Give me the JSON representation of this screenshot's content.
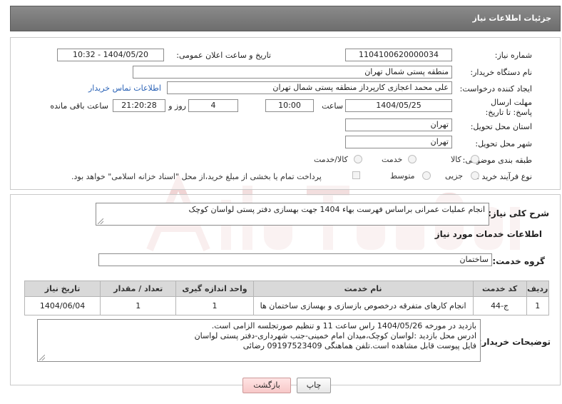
{
  "header": {
    "title": "جزئیات اطلاعات نیاز"
  },
  "fields": {
    "need_number_label": "شماره نیاز:",
    "need_number": "1104100620000034",
    "announce_label": "تاریخ و ساعت اعلان عمومی:",
    "announce_value": "1404/05/20 - 10:32",
    "buyer_org_label": "نام دستگاه خریدار:",
    "buyer_org": "منطقه پستی شمال تهران",
    "requester_label": "ایجاد کننده درخواست:",
    "requester": "علی محمد اعجازی کارپرداز منطقه پستی شمال تهران",
    "contact_link": "اطلاعات تماس خریدار",
    "deadline_label": "مهلت ارسال پاسخ: تا تاریخ:",
    "deadline_date": "1404/05/25",
    "time_label": "ساعت",
    "deadline_time": "10:00",
    "days_value": "4",
    "days_label": "روز و",
    "remaining_time": "21:20:28",
    "remaining_label": "ساعت باقی مانده",
    "province_label": "استان محل تحویل:",
    "province": "تهران",
    "city_label": "شهر محل تحویل:",
    "city": "تهران",
    "category_label": "طبقه بندی موضوعی:",
    "category_options": [
      "کالا",
      "خدمت",
      "کالا/خدمت"
    ],
    "process_label": "نوع فرآیند خرید :",
    "process_options": [
      "جزیی",
      "متوسط"
    ],
    "payment_note": "پرداخت تمام یا بخشی از مبلغ خرید،از محل \"اسناد خزانه اسلامی\" خواهد بود."
  },
  "summary": {
    "label": "شرح کلی نیاز:",
    "text": "انجام عملیات عمرانی براساس فهرست بهاء 1404 جهت بهسازی دفتر پستی لواسان کوچک"
  },
  "services": {
    "section_title": "اطلاعات خدمات مورد نیاز",
    "group_label": "گروه خدمت:",
    "group_value": "ساختمان",
    "columns": [
      "ردیف",
      "کد خدمت",
      "نام خدمت",
      "واحد اندازه گیری",
      "تعداد / مقدار",
      "تاریخ نیاز"
    ],
    "rows": [
      [
        "1",
        "ج-44",
        "انجام کارهای متفرقه درخصوص بازسازی و بهسازی ساختمان ها",
        "1",
        "1",
        "1404/06/04"
      ]
    ]
  },
  "buyer_notes": {
    "label": "توضیحات خریدار:",
    "lines": [
      "بازدید در مورخه 1404/05/26 راس ساعت 11 و تنظیم صورتجلسه الزامی است.",
      "ادرس محل بازدید :لواسان کوچک،میدان امام خمینی-جنب شهرداری-دفتر پستی لواسان",
      "فایل پیوست قابل مشاهده است.تلفن هماهنگی 09197523409 رضائی"
    ]
  },
  "buttons": {
    "print": "چاپ",
    "back": "بازگشت"
  },
  "colors": {
    "header_bg": "#7a7a7a",
    "link": "#2a62b6",
    "back_button": "#f7c8c8"
  }
}
